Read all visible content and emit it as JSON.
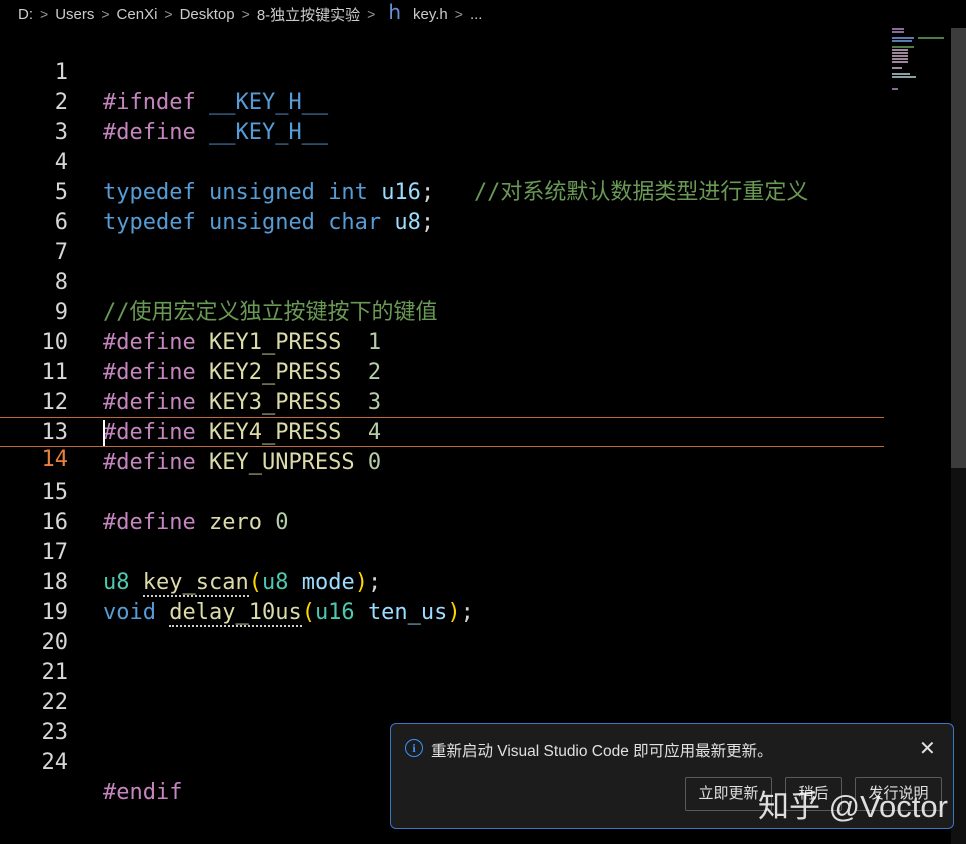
{
  "breadcrumb": {
    "items": [
      "D:",
      "Users",
      "CenXi",
      "Desktop",
      "8-独立按键实验",
      "key.h",
      "..."
    ],
    "separator": ">",
    "file_icon": "h"
  },
  "editor": {
    "current_line": 14,
    "lines": [
      {
        "n": "1"
      },
      {
        "n": "2"
      },
      {
        "n": "3"
      },
      {
        "n": "4"
      },
      {
        "n": "5"
      },
      {
        "n": "6"
      },
      {
        "n": "7"
      },
      {
        "n": "8"
      },
      {
        "n": "9"
      },
      {
        "n": "10"
      },
      {
        "n": "11"
      },
      {
        "n": "12"
      },
      {
        "n": "13"
      },
      {
        "n": "14"
      },
      {
        "n": "15"
      },
      {
        "n": "16"
      },
      {
        "n": "17"
      },
      {
        "n": "18"
      },
      {
        "n": "19"
      },
      {
        "n": "20"
      },
      {
        "n": "21"
      },
      {
        "n": "22"
      },
      {
        "n": "23"
      },
      {
        "n": "24"
      }
    ],
    "code": {
      "l1_kw": "#ifndef",
      "l1_name": "__KEY_H__",
      "l2_kw": "#define",
      "l2_name": "__KEY_H__",
      "l4_typedef": "typedef",
      "l4_unsigned": "unsigned",
      "l4_int": "int",
      "l4_alias": "u16",
      "l4_semi": ";",
      "l4_comment": "//对系统默认数据类型进行重定义",
      "l5_typedef": "typedef",
      "l5_unsigned": "unsigned",
      "l5_char": "char",
      "l5_alias": "u8",
      "l5_semi": ";",
      "l8_comment": "//使用宏定义独立按键按下的键值",
      "l9_kw": "#define",
      "l9_name": "KEY1_PRESS",
      "l9_val": "1",
      "l10_kw": "#define",
      "l10_name": "KEY2_PRESS",
      "l10_val": "2",
      "l11_kw": "#define",
      "l11_name": "KEY3_PRESS",
      "l11_val": "3",
      "l12_kw": "#define",
      "l12_name": "KEY4_PRESS",
      "l12_val": "4",
      "l13_kw": "#define",
      "l13_name": "KEY_UNPRESS",
      "l13_val": "0",
      "l15_kw": "#define",
      "l15_name": "zero",
      "l15_val": "0",
      "l17_type": "u8",
      "l17_fn": "key_scan",
      "l17_open": "(",
      "l17_ptype": "u8",
      "l17_param": "mode",
      "l17_close": ")",
      "l17_semi": ";",
      "l18_type": "void",
      "l18_fn": "delay_10us",
      "l18_open": "(",
      "l18_ptype": "u16",
      "l18_param": "ten_us",
      "l18_close": ")",
      "l18_semi": ";",
      "l24_kw": "#endif"
    }
  },
  "notification": {
    "message": "重新启动 Visual Studio Code 即可应用最新更新。",
    "buttons": [
      "立即更新",
      "稍后",
      "发行说明"
    ],
    "close_glyph": "✕",
    "info_glyph": "i"
  },
  "watermark": "知乎 @Voctor",
  "colors": {
    "background": "#000000",
    "accent_border": "#3a78c0",
    "current_line_border": "#c2693a",
    "preprocessor": "#c586c0",
    "keyword": "#569cd6",
    "comment": "#6a9955"
  }
}
